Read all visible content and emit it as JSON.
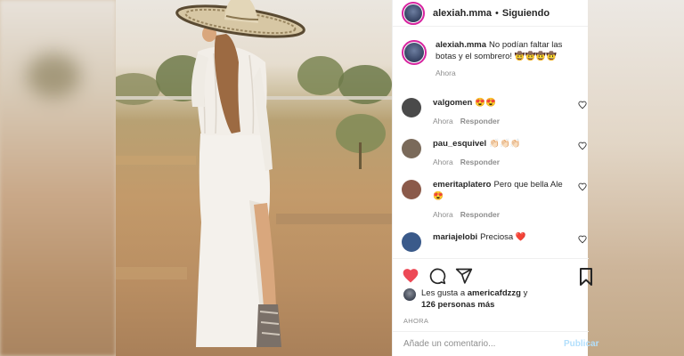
{
  "post": {
    "username": "alexiah.mma",
    "dot": "•",
    "follow_status": "Siguiendo"
  },
  "caption": {
    "username": "alexiah.mma",
    "text": "No podían faltar las botas y el sombrero! 🤠🤠🤠🤠",
    "time": "Ahora"
  },
  "comments": [
    {
      "username": "valgomen",
      "text": "😍😍",
      "time": "Ahora",
      "reply": "Responder",
      "avatar_color": "#4a4a4a"
    },
    {
      "username": "pau_esquivel",
      "text": "👏🏻👏🏻👏🏻",
      "time": "Ahora",
      "reply": "Responder",
      "avatar_color": "#7a6a5a"
    },
    {
      "username": "emeritaplatero",
      "text": "Pero que bella Ale 😍",
      "time": "Ahora",
      "reply": "Responder",
      "avatar_color": "#8b5a4a"
    },
    {
      "username": "mariajelobi",
      "text": "Preciosa ❤️",
      "time": "",
      "reply": "",
      "avatar_color": "#3a5a8a"
    }
  ],
  "likes": {
    "prefix": "Les gusta a ",
    "user": "americafdzzg",
    "middle": " y",
    "count": "126 personas más"
  },
  "timestamp": "AHORA",
  "add_comment": {
    "placeholder": "Añade un comentario...",
    "publish": "Publicar"
  },
  "colors": {
    "like_heart": "#ed4956",
    "story_ring": "#d6249f",
    "publish_disabled": "#b2dffc",
    "secondary_text": "#8e8e8e"
  }
}
